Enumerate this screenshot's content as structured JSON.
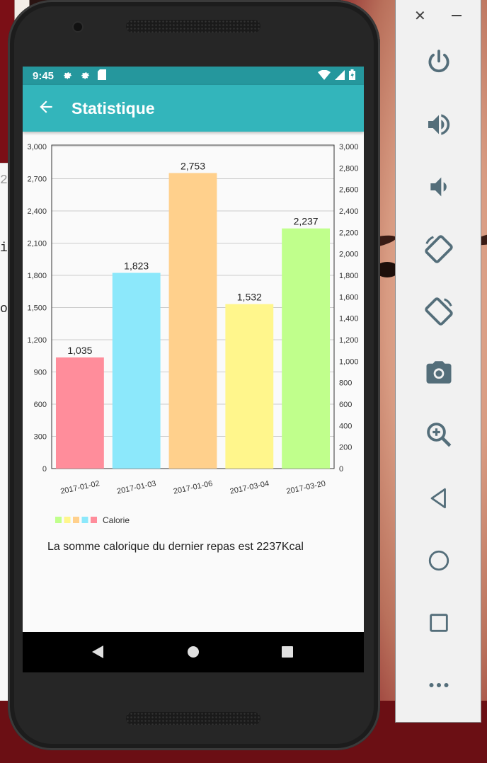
{
  "status_bar": {
    "time": "9:45"
  },
  "app_bar": {
    "title": "Statistique"
  },
  "summary_text": "La somme calorique du dernier repas est 2237Kcal",
  "chart_data": {
    "type": "bar",
    "categories": [
      "2017-01-02",
      "2017-01-03",
      "2017-01-06",
      "2017-03-04",
      "2017-03-20"
    ],
    "values": [
      1035,
      1823,
      2753,
      1532,
      2237
    ],
    "value_labels": [
      "1,035",
      "1,823",
      "2,753",
      "1,532",
      "2,237"
    ],
    "bar_colors": [
      "#ff8d9b",
      "#8ce8fb",
      "#ffd08c",
      "#fff68c",
      "#c0ff8c"
    ],
    "legend_colors": [
      "#c0ff8c",
      "#fff68c",
      "#ffd08c",
      "#8ce8fb",
      "#ff8d9b"
    ],
    "series": [
      {
        "name": "Calorie",
        "values": [
          1035,
          1823,
          2753,
          1532,
          2237
        ]
      }
    ],
    "left_axis": {
      "ylim": [
        0,
        3000
      ],
      "ticks": [
        "0",
        "300",
        "600",
        "900",
        "1,200",
        "1,500",
        "1,800",
        "2,100",
        "2,400",
        "2,700",
        "3,000"
      ]
    },
    "right_axis": {
      "ylim": [
        0,
        3000
      ],
      "ticks": [
        "0",
        "200",
        "400",
        "600",
        "800",
        "1,000",
        "1,200",
        "1,400",
        "1,600",
        "1,800",
        "2,000",
        "2,200",
        "2,400",
        "2,600",
        "2,800",
        "3,000"
      ]
    },
    "grid": true,
    "legend_position": "bottom-left"
  },
  "background_text": [
    "2:",
    "i",
    "o"
  ],
  "colors": {
    "status_bar": "#25979d",
    "app_bar": "#33b5bb",
    "panel_icon": "#546e7a"
  }
}
